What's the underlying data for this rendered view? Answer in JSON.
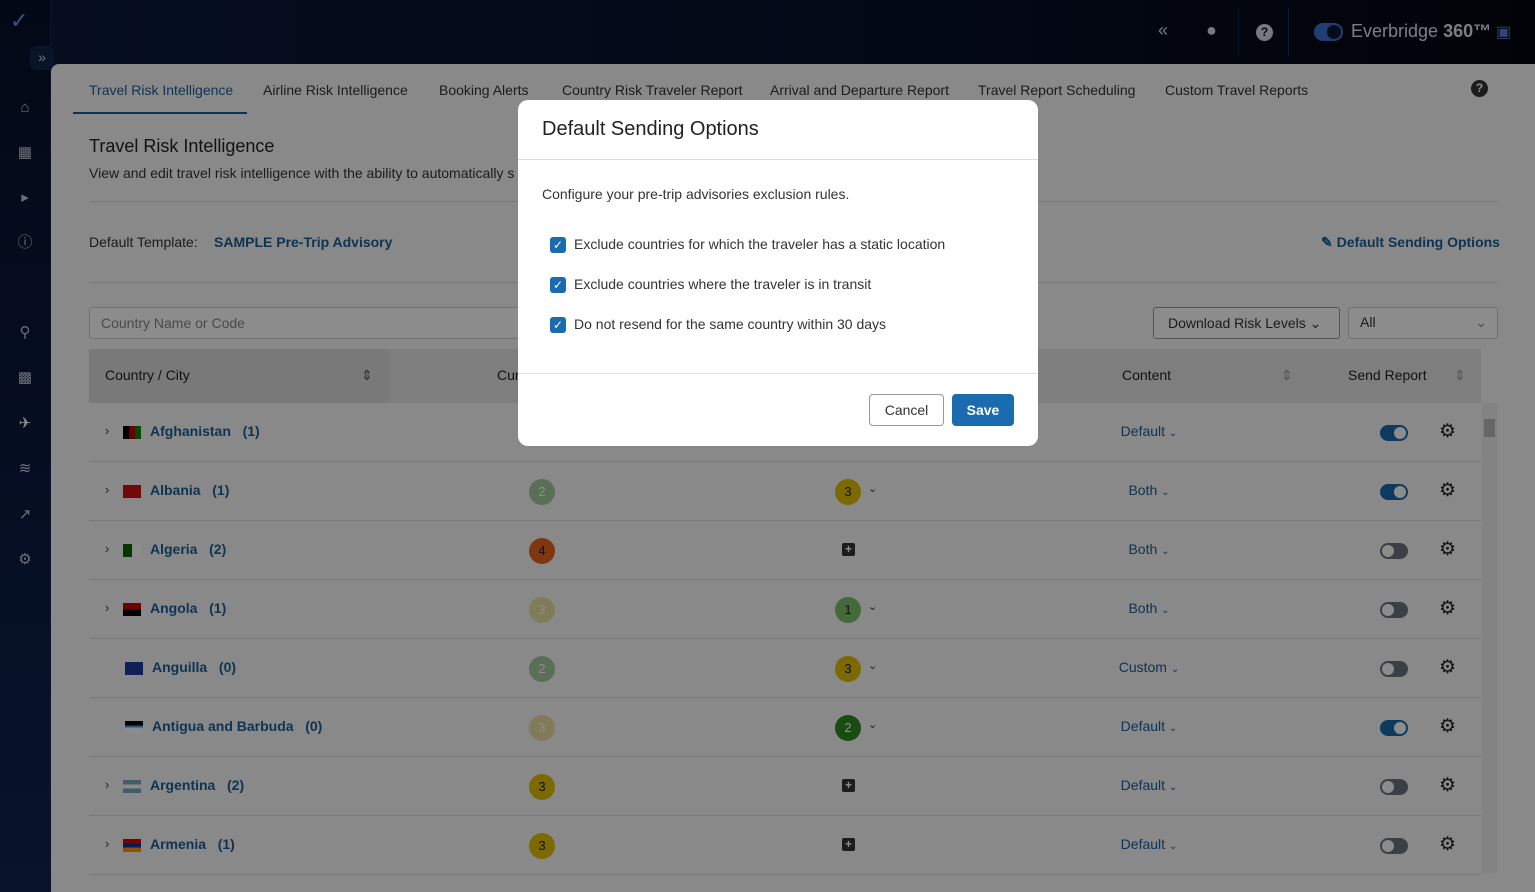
{
  "header": {
    "brand": "Everbridge",
    "brand_suffix": "360™",
    "collapse_icon": "«",
    "help": "?"
  },
  "tabs": [
    "Travel Risk Intelligence",
    "Airline Risk Intelligence",
    "Booking Alerts",
    "Country Risk Traveler Report",
    "Arrival and Departure Report",
    "Travel Report Scheduling",
    "Custom Travel Reports"
  ],
  "page": {
    "title": "Travel Risk Intelligence",
    "subtitle": "View and edit travel risk intelligence with the ability to automatically s",
    "template_label": "Default Template:",
    "template_value": "SAMPLE Pre-Trip Advisory",
    "default_sending_options": "Default Sending Options"
  },
  "filters": {
    "search_placeholder": "Country Name or Code",
    "download": "Download Risk Levels",
    "select_value": "All"
  },
  "table": {
    "headers": {
      "country": "Country / City",
      "current": "Cur",
      "content": "Content",
      "send": "Send Report"
    },
    "rows": [
      {
        "name": "Afghanistan",
        "count": "(1)",
        "expand": true,
        "content": "Default",
        "send": true
      },
      {
        "name": "Albania",
        "count": "(1)",
        "expand": true,
        "cur": "2",
        "level": "3",
        "content": "Both",
        "send": true
      },
      {
        "name": "Algeria",
        "count": "(2)",
        "expand": true,
        "cur": "4",
        "level": "+",
        "content": "Both",
        "send": false
      },
      {
        "name": "Angola",
        "count": "(1)",
        "expand": true,
        "cur": "3",
        "level": "1",
        "content": "Both",
        "send": false
      },
      {
        "name": "Anguilla",
        "count": "(0)",
        "expand": false,
        "cur": "2",
        "level": "3",
        "content": "Custom",
        "send": false
      },
      {
        "name": "Antigua and Barbuda",
        "count": "(0)",
        "expand": false,
        "cur": "3",
        "level": "2",
        "content": "Default",
        "send": true
      },
      {
        "name": "Argentina",
        "count": "(2)",
        "expand": true,
        "cur": "3",
        "level": "+",
        "content": "Default",
        "send": false
      },
      {
        "name": "Armenia",
        "count": "(1)",
        "expand": true,
        "cur": "3",
        "level": "+",
        "content": "Default",
        "send": false
      }
    ]
  },
  "modal": {
    "title": "Default Sending Options",
    "description": "Configure your pre-trip advisories exclusion rules.",
    "options": [
      {
        "label": "Exclude countries for which the traveler has a static location",
        "checked": true
      },
      {
        "label": "Exclude countries where the traveler is in transit",
        "checked": true
      },
      {
        "label": "Do not resend for the same country within 30 days",
        "checked": true
      }
    ],
    "cancel": "Cancel",
    "save": "Save"
  },
  "colors": {
    "accent": "#1b6bb0",
    "link": "#1b5e97"
  }
}
